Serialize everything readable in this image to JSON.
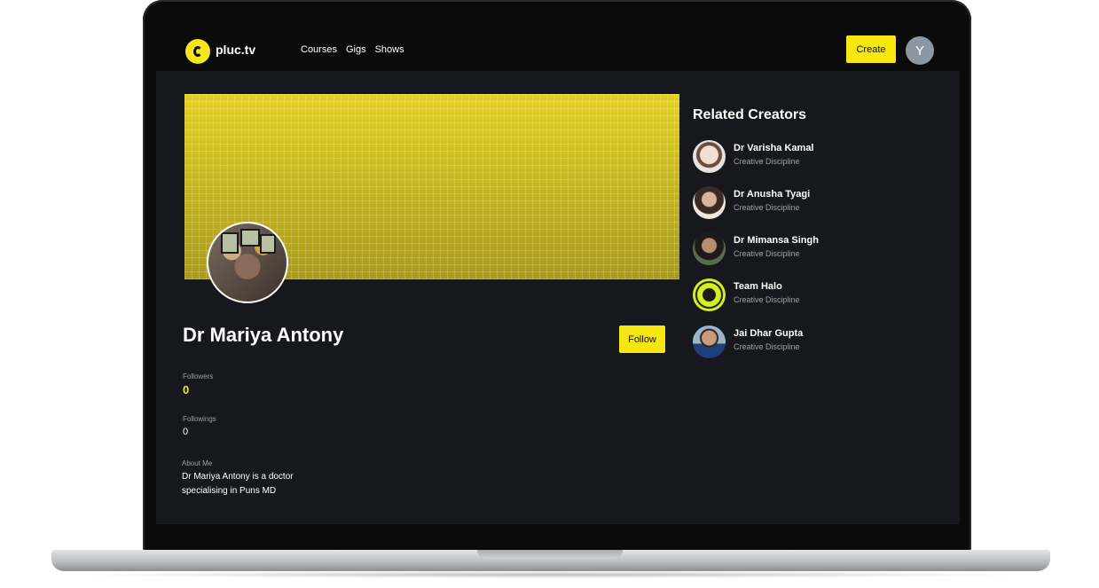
{
  "app": {
    "logo_text": "pluc.tv"
  },
  "nav": {
    "items": [
      "Courses",
      "Gigs",
      "Shows"
    ]
  },
  "header": {
    "create_label": "Create",
    "avatar_initial": "Y"
  },
  "profile": {
    "name": "Dr Mariya Antony",
    "follow_label": "Follow",
    "followers_label": "Followers",
    "followers_count": "0",
    "followings_label": "Followings",
    "followings_count": "0",
    "about_label": "About Me",
    "about_text": "Dr Mariya Antony is a doctor specialising in Puns MD"
  },
  "related": {
    "title": "Related Creators",
    "creators": [
      {
        "name": "Dr Varisha Kamal",
        "discipline": "Creative Discipline"
      },
      {
        "name": "Dr Anusha Tyagi",
        "discipline": "Creative Discipline"
      },
      {
        "name": "Dr Mimansa Singh",
        "discipline": "Creative Discipline"
      },
      {
        "name": "Team Halo",
        "discipline": "Creative Discipline"
      },
      {
        "name": "Jai Dhar Gupta",
        "discipline": "Creative Discipline"
      }
    ]
  },
  "colors": {
    "accent": "#f6e710",
    "background": "#16181d",
    "topbar": "#0b0b0c"
  }
}
